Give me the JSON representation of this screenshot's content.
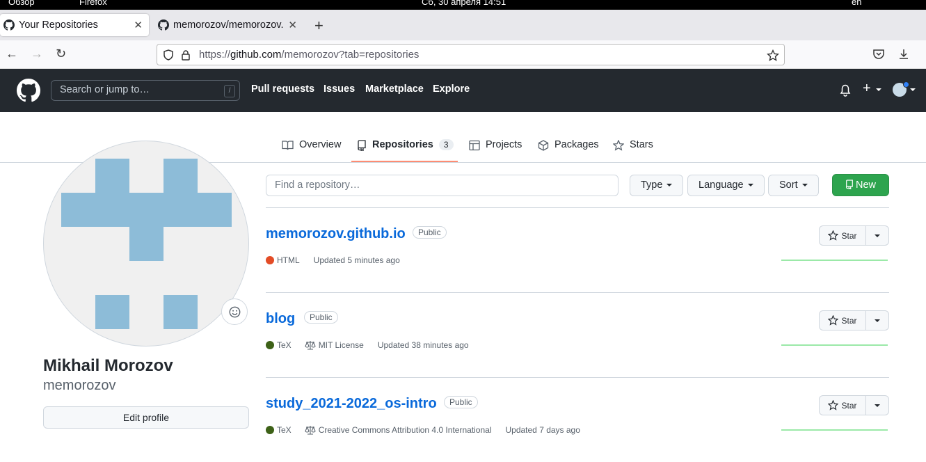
{
  "os": {
    "left_text": "Обзор",
    "app_text": "Firefox",
    "clock": "Сб, 30 апреля  14:51",
    "lang": "en"
  },
  "browser": {
    "tabs": [
      {
        "title": "Your Repositories",
        "active": true
      },
      {
        "title": "memorozov/memorozov.",
        "active": false
      }
    ],
    "url_prefix": "https://",
    "url_domain": "github.com",
    "url_rest": "/memorozov?tab=repositories"
  },
  "github": {
    "search_placeholder": "Search or jump to…",
    "search_key": "/",
    "nav": [
      "Pull requests",
      "Issues",
      "Marketplace",
      "Explore"
    ]
  },
  "profile_tabs": [
    {
      "label": "Overview"
    },
    {
      "label": "Repositories",
      "count": "3",
      "selected": true
    },
    {
      "label": "Projects"
    },
    {
      "label": "Packages"
    },
    {
      "label": "Stars"
    }
  ],
  "profile": {
    "name": "Mikhail Morozov",
    "login": "memorozov",
    "edit_label": "Edit profile"
  },
  "filters": {
    "find_placeholder": "Find a repository…",
    "type_label": "Type",
    "language_label": "Language",
    "sort_label": "Sort",
    "new_label": "New"
  },
  "repos": [
    {
      "name": "memorozov.github.io",
      "visibility": "Public",
      "language": "HTML",
      "language_color": "#e34c26",
      "license": "",
      "updated": "Updated 5 minutes ago",
      "star_label": "Star"
    },
    {
      "name": "blog",
      "visibility": "Public",
      "language": "TeX",
      "language_color": "#3D6117",
      "license": "MIT License",
      "updated": "Updated 38 minutes ago",
      "star_label": "Star"
    },
    {
      "name": "study_2021-2022_os-intro",
      "visibility": "Public",
      "language": "TeX",
      "language_color": "#3D6117",
      "license": "Creative Commons Attribution 4.0 International",
      "updated": "Updated 7 days ago",
      "star_label": "Star"
    }
  ]
}
